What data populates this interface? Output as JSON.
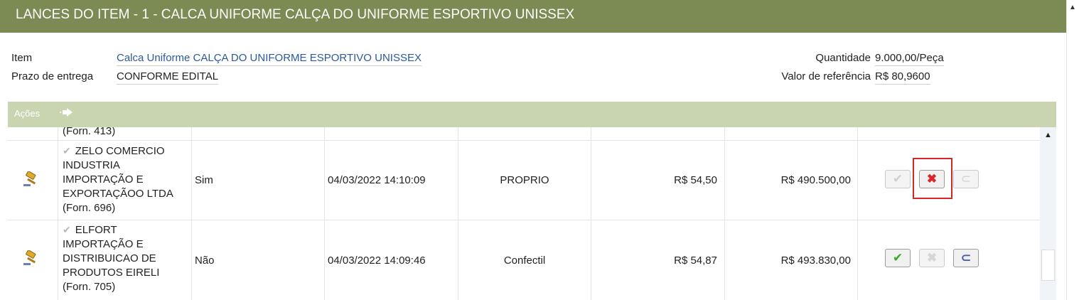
{
  "header": {
    "title": "LANCES DO ITEM - 1 - CALCA UNIFORME CALÇA DO UNIFORME ESPORTIVO UNISSEX"
  },
  "info": {
    "item_label": "Item",
    "item_value": "Calca Uniforme CALÇA DO UNIFORME ESPORTIVO UNISSEX",
    "prazo_label": "Prazo de entrega",
    "prazo_value": "CONFORME EDITAL",
    "quantidade_label": "Quantidade",
    "quantidade_value": "9.000,00/Peça",
    "valor_ref_label": "Valor de referência",
    "valor_ref_value": "R$ 80,9600"
  },
  "actions_bar": {
    "label": "Ações",
    "arrow_icon": "arrow-right-icon"
  },
  "bids": {
    "partial": {
      "supplier_tail": "(Forn. 413)"
    },
    "rows": [
      {
        "supplier_lines": [
          "ZELO COMERCIO",
          "INDUSTRIA",
          "IMPORTAÇÃO E",
          "EXPORTAÇÃOO LTDA",
          "(Forn. 696)"
        ],
        "me_epp": "Sim",
        "datetime": "04/03/2022 14:10:09",
        "brand": "PROPRIO",
        "unit_value": "R$ 54,50",
        "total_value": "R$ 490.500,00",
        "accept_enabled": false,
        "reject_enabled": true,
        "attach_enabled": false
      },
      {
        "supplier_lines": [
          "ELFORT",
          "IMPORTAÇÃO E",
          "DISTRIBUICAO DE",
          "PRODUTOS EIRELI",
          "(Forn. 705)"
        ],
        "me_epp": "Não",
        "datetime": "04/03/2022 14:09:46",
        "brand": "Confectil",
        "unit_value": "R$ 54,87",
        "total_value": "R$ 493.830,00",
        "accept_enabled": true,
        "reject_enabled": false,
        "attach_enabled": true
      }
    ]
  },
  "colors": {
    "header_bg": "#7b8b53",
    "actions_bg": "#c8d5b0",
    "link": "#2c5a9a",
    "highlight": "#d9262a"
  }
}
